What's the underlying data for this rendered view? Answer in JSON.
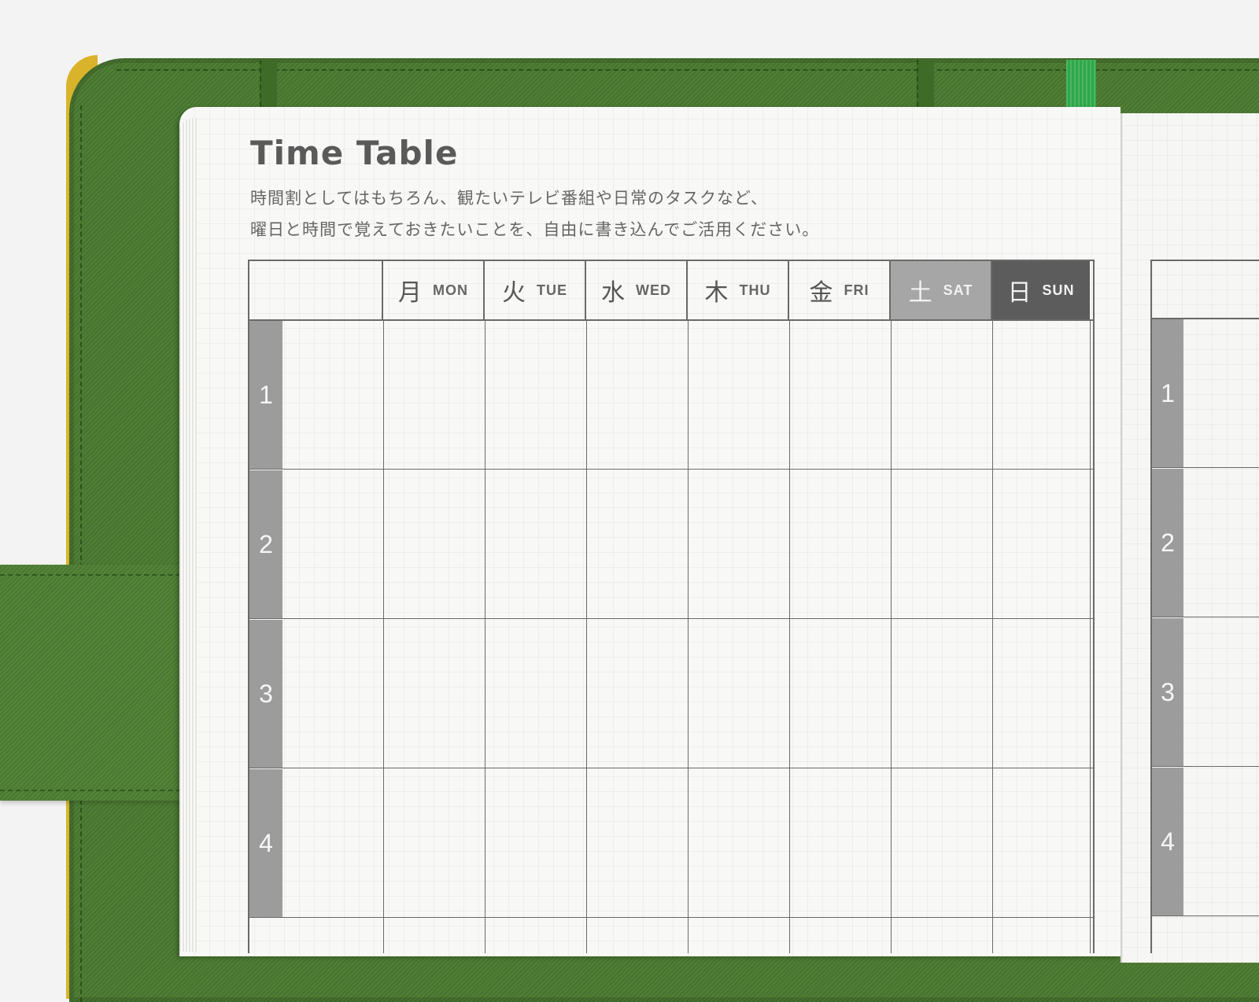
{
  "title": "Time Table",
  "description": [
    "時間割としてはもちろん、観たいテレビ番組や日常のタスクなど、",
    "曜日と時間で覚えておきたいことを、自由に書き込んでご活用ください。"
  ],
  "days": [
    {
      "jp": "月",
      "en": "MON"
    },
    {
      "jp": "火",
      "en": "TUE"
    },
    {
      "jp": "水",
      "en": "WED"
    },
    {
      "jp": "木",
      "en": "THU"
    },
    {
      "jp": "金",
      "en": "FRI"
    },
    {
      "jp": "土",
      "en": "SAT"
    },
    {
      "jp": "日",
      "en": "SUN"
    }
  ],
  "periods": [
    "1",
    "2",
    "3",
    "4"
  ],
  "right_page_periods": [
    "1",
    "2",
    "3",
    "4"
  ],
  "colors": {
    "cover": "#4a7a30",
    "cover_edge": "#d9b42a",
    "ribbon": "#2ea84a",
    "saturday_header": "#a6a6a6",
    "sunday_header": "#5c5c5c",
    "period_bar": "#9c9c9c"
  }
}
